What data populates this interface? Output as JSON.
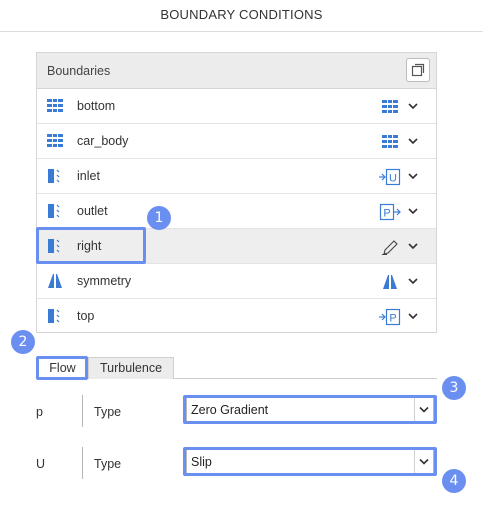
{
  "header": {
    "title": "BOUNDARY CONDITIONS"
  },
  "boundaries": {
    "title": "Boundaries",
    "copy_icon": "copy-icon",
    "items": [
      {
        "label": "bottom",
        "icon": "wall-icon",
        "type_icon": "wall-type-icon"
      },
      {
        "label": "car_body",
        "icon": "wall-icon",
        "type_icon": "wall-type-icon"
      },
      {
        "label": "inlet",
        "icon": "patch-icon",
        "type_icon": "velocity-inlet-icon",
        "type_letter": "U"
      },
      {
        "label": "outlet",
        "icon": "patch-icon",
        "type_icon": "pressure-outlet-icon",
        "type_letter": "P"
      },
      {
        "label": "right",
        "icon": "patch-icon",
        "type_icon": "pencil-icon",
        "selected": true
      },
      {
        "label": "symmetry",
        "icon": "symmetry-icon",
        "type_icon": "symmetry-type-icon"
      },
      {
        "label": "top",
        "icon": "patch-icon",
        "type_icon": "pressure-inlet-icon",
        "type_letter": "P"
      }
    ]
  },
  "tabs": [
    {
      "label": "Flow",
      "active": true
    },
    {
      "label": "Turbulence",
      "active": false
    }
  ],
  "fields": [
    {
      "variable": "p",
      "label": "Type",
      "value": "Zero Gradient"
    },
    {
      "variable": "U",
      "label": "Type",
      "value": "Slip"
    }
  ],
  "callouts": [
    "1",
    "2",
    "3",
    "4"
  ],
  "colors": {
    "accent": "#6b8ff0",
    "icon_blue": "#3a7bd5"
  }
}
